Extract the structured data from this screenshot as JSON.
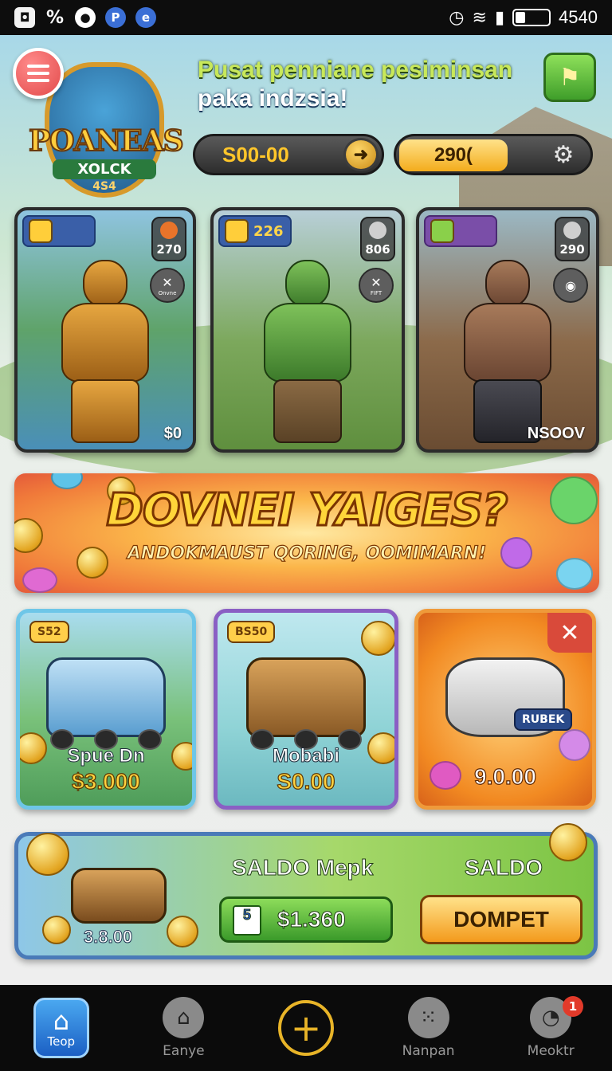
{
  "status_bar": {
    "time": "4540",
    "icons": [
      "app-icon",
      "percent-icon",
      "media-icon",
      "p-icon",
      "browser-icon"
    ],
    "right_icons": [
      "alarm-icon",
      "wifi-icon",
      "signal-icon",
      "battery-icon"
    ]
  },
  "header": {
    "headline_line1": "Pusat penniane pesiminsan",
    "headline_line2": "paka indzsia!",
    "logo_title": "POANEAS",
    "logo_sub": "XOLCK",
    "logo_num": "4S4",
    "balance_left": "S00-00",
    "balance_right": "290("
  },
  "heroes": [
    {
      "tag_value": "",
      "count": "270",
      "ctrl_label": "Onvne",
      "price": "$0"
    },
    {
      "tag_value": "226",
      "count": "806",
      "ctrl_label": "FIFT",
      "price": ""
    },
    {
      "tag_value": "",
      "count": "290",
      "ctrl_label": "",
      "price": "NSOOV"
    }
  ],
  "banner": {
    "title": "DOVNEI YAIGES?",
    "subtitle": "ANDOKMAUST QORING, OOMIMARN!"
  },
  "shop": [
    {
      "tag": "S52",
      "name": "Spue Dn",
      "price": "$3.000"
    },
    {
      "tag": "BS50",
      "name": "Mobabi",
      "price": "S0.00"
    },
    {
      "tag": "RUBEK",
      "name": "",
      "price": "9.0.00"
    }
  ],
  "saldo": {
    "left_value": "3.8.00",
    "title": "SALDO Mepk",
    "amount": "$1.360",
    "doc_glyph": "5",
    "right_title": "SALDO",
    "wallet_button": "DOMPET"
  },
  "bottom_nav": {
    "items": [
      "Teop",
      "Eanye",
      "",
      "Nanpan",
      "Meoktr"
    ],
    "badge": "1"
  },
  "colors": {
    "accent_green": "#3f9e2a",
    "gold": "#f3ac1c",
    "banner_orange": "#f07a3a",
    "nav_active": "#1b5fc4"
  }
}
